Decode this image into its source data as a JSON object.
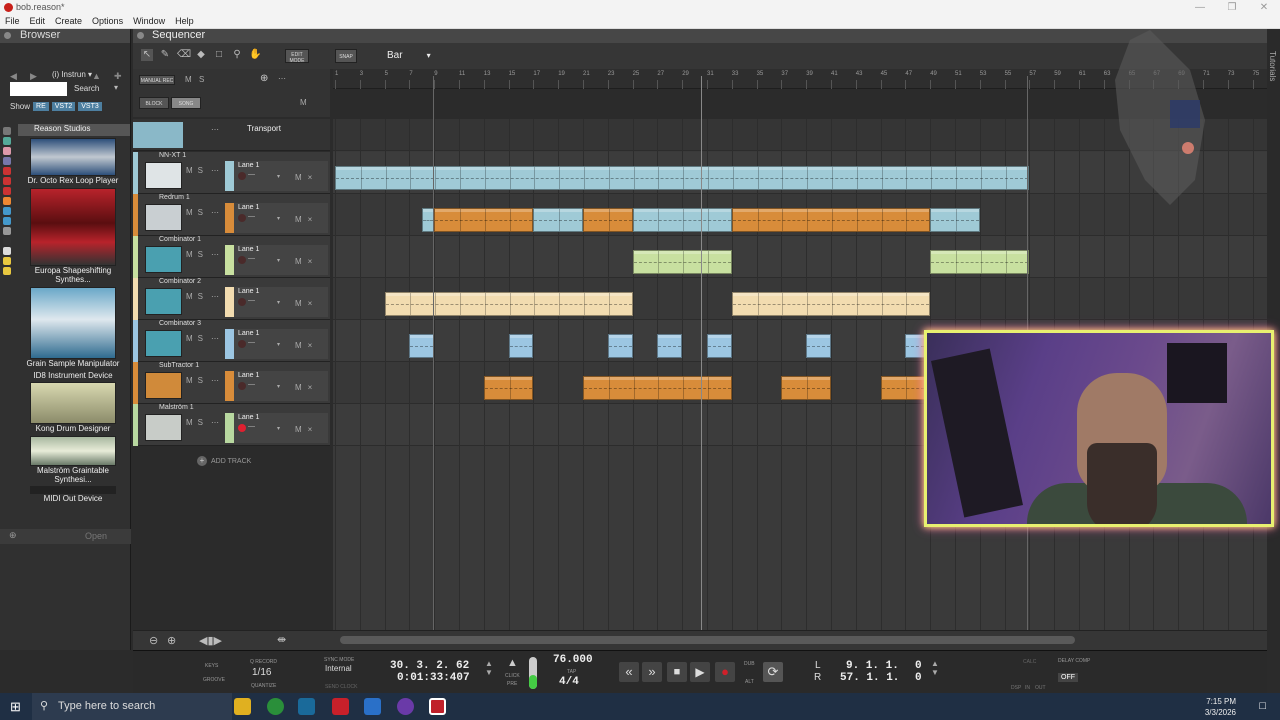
{
  "window": {
    "title": "bob.reason*"
  },
  "menu": [
    "File",
    "Edit",
    "Create",
    "Options",
    "Window",
    "Help"
  ],
  "browser": {
    "title": "Browser",
    "instrument_filter": "Instrun",
    "search_label": "Search",
    "show_label": "Show",
    "show_chips": [
      "RE",
      "VST2",
      "VST3"
    ],
    "folder": "Reason Studios",
    "devices": [
      "Dr. Octo Rex Loop Player",
      "Europa Shapeshifting Synthes...",
      "Grain Sample Manipulator",
      "ID8 Instrument Device",
      "Kong Drum Designer",
      "Malström Graintable Synthesi...",
      "MIDI Out Device"
    ],
    "open_label": "Open"
  },
  "sequencer": {
    "title": "Sequencer",
    "edit_mode": "EDIT MODE",
    "snap": "SNAP",
    "snap_value": "Bar",
    "manual_rec": "MANUAL REC",
    "block": "BLOCK",
    "song": "SONG",
    "m_label": "M",
    "s_label": "S",
    "ruler_ticks": [
      "1",
      "3",
      "5",
      "7",
      "9",
      "11",
      "13",
      "15",
      "17",
      "19",
      "21",
      "23",
      "25",
      "27",
      "29",
      "31",
      "33",
      "35",
      "37",
      "39",
      "41",
      "43",
      "45",
      "47",
      "49",
      "51",
      "53",
      "55",
      "57",
      "59",
      "61",
      "63",
      "65",
      "67",
      "69",
      "71",
      "73",
      "75"
    ],
    "transport_track": "Transport",
    "add_track": "ADD TRACK",
    "tracks": [
      {
        "name": "NN-XT 1",
        "lane": "Lane 1",
        "color": "#9fcad6"
      },
      {
        "name": "Redrum 1",
        "lane": "Lane 1",
        "color": "#d88c3a"
      },
      {
        "name": "Combinator 1",
        "lane": "Lane 1",
        "color": "#c8e0a0"
      },
      {
        "name": "Combinator 2",
        "lane": "Lane 1",
        "color": "#f2dcb0"
      },
      {
        "name": "Combinator 3",
        "lane": "Lane 1",
        "color": "#9cc6e2"
      },
      {
        "name": "SubTractor 1",
        "lane": "Lane 1",
        "color": "#d88c3a"
      },
      {
        "name": "Malström 1",
        "lane": "Lane 1",
        "color": "#b8d8a0"
      }
    ]
  },
  "transport": {
    "keys": "KEYS",
    "groove": "GROOVE",
    "q_record": "Q RECORD",
    "quantize_value": "1/16",
    "quantize": "QUANTIZE",
    "sync_mode": "SYNC MODE",
    "sync_value": "Internal",
    "send_clock": "SEND CLOCK",
    "position_bars": "30. 3. 2. 62",
    "position_time": "0:01:33:407",
    "click": "CLICK",
    "pre": "PRE",
    "tempo": "76.000",
    "tap": "TAP",
    "signature": "4/4",
    "dub": "DUB",
    "alt": "ALT",
    "left_loc_label": "L",
    "right_loc_label": "R",
    "left_loc": "9. 1. 1.",
    "left_loc_tick": "0",
    "right_loc": "57. 1. 1.",
    "right_loc_tick": "0",
    "calc": "CALC",
    "dsp": "DSP",
    "in": "IN",
    "out": "OUT",
    "delay_comp": "DELAY COMP",
    "delay_comp_state": "OFF"
  },
  "right_panel": "Tutorials",
  "taskbar": {
    "search_placeholder": "Type here to search",
    "time": "7:15 PM",
    "date": "3/3/2026"
  }
}
